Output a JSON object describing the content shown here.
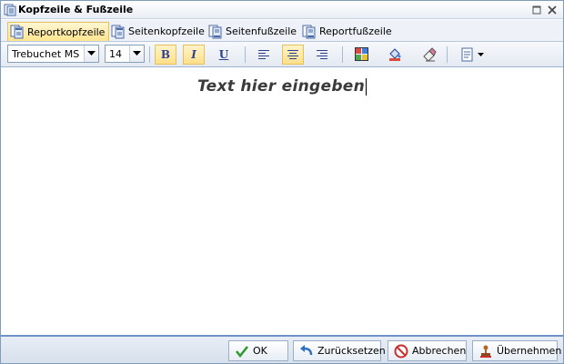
{
  "window": {
    "title": "Kopfzeile & Fußzeile",
    "icon": "document-icon",
    "controls": [
      "maximize-icon",
      "close-icon"
    ]
  },
  "tabs": [
    {
      "label": "Reportkopfzeile",
      "active": true,
      "icon": "report-header-icon"
    },
    {
      "label": "Seitenkopfzeile",
      "active": false,
      "icon": "page-header-icon"
    },
    {
      "label": "Seitenfußzeile",
      "active": false,
      "icon": "page-footer-icon"
    },
    {
      "label": "Reportfußzeile",
      "active": false,
      "icon": "report-footer-icon"
    }
  ],
  "toolbar": {
    "font_family": "Trebuchet MS",
    "font_size": "14",
    "bold_label": "B",
    "italic_label": "I",
    "underline_label": "U",
    "bold_active": true,
    "italic_active": true,
    "align_center_active": true
  },
  "editor": {
    "text": "Text hier eingeben"
  },
  "footer": {
    "ok_label": "OK",
    "reset_label": "Zurücksetzen",
    "cancel_label": "Abbrechen",
    "apply_label": "Übernehmen"
  },
  "colors": {
    "accent_border": "#6f93c9",
    "active_tab": "#ffe58f",
    "toolbar_bg": "#e4eaf2"
  }
}
